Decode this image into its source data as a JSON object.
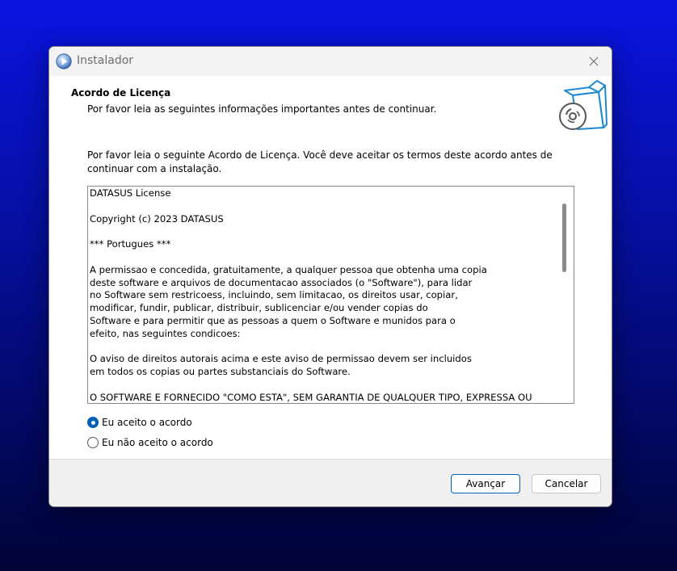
{
  "window": {
    "title": "Instalador",
    "icons": {
      "app": "play-disc-icon",
      "close": "close-icon",
      "header": "open-box-disc-icon"
    }
  },
  "header": {
    "title": "Acordo de Licença",
    "subtitle": "Por favor leia as seguintes informações importantes antes de continuar."
  },
  "intro": {
    "text": "Por favor leia o seguinte Acordo de Licença. Você deve aceitar os termos deste acordo antes de continuar com a instalação."
  },
  "license": {
    "text": "DATASUS License\n\nCopyright (c) 2023 DATASUS\n\n*** Portugues ***\n\nA permissao e concedida, gratuitamente, a qualquer pessoa que obtenha uma copia\ndeste software e arquivos de documentacao associados (o \"Software\"), para lidar\nno Software sem restricoess, incluindo, sem limitacao, os direitos usar, copiar,\nmodificar, fundir, publicar, distribuir, sublicenciar e/ou vender copias do\nSoftware e para permitir que as pessoas a quem o Software e munidos para o\nefeito, nas seguintes condicoes:\n\nO aviso de direitos autorais acima e este aviso de permissao devem ser incluidos\nem todos os copias ou partes substanciais do Software.\n\nO SOFTWARE E FORNECIDO \"COMO ESTA\", SEM GARANTIA DE QUALQUER TIPO, EXPRESSA OU"
  },
  "options": {
    "accept": {
      "label": "Eu aceito o acordo",
      "selected": true
    },
    "decline": {
      "label": "Eu não aceito o acordo",
      "selected": false
    }
  },
  "buttons": {
    "next": "Avançar",
    "cancel": "Cancelar"
  },
  "colors": {
    "accent": "#005fb8",
    "icon_blue": "#1e88d0",
    "icon_gray": "#555555"
  }
}
